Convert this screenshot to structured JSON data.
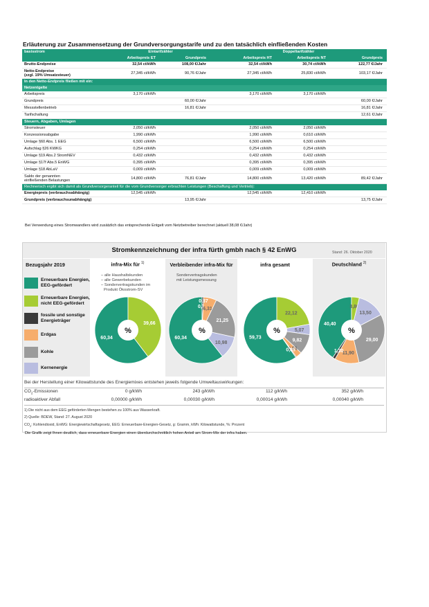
{
  "title": "Erläuterung zur Zusammensetzung der Grundversorgungstarife und zu den tatsächlich einfließenden Kosten",
  "table": {
    "h_product": "basisstrom",
    "h_eintarif": "Eintarifzähler",
    "h_doppel": "Doppeltarifzähler",
    "h_arb_et": "Arbeitspreis ET",
    "h_grund1": "Grundpreis",
    "h_arb_ht": "Arbeitspreis HT",
    "h_arb_nt": "Arbeitspreis NT",
    "h_grund2": "Grundpreis",
    "brutto": {
      "label": "Brutto-Endpreise",
      "et": "32,54 ct/kWh",
      "g1": "108,00 €/Jahr",
      "ht": "32,54 ct/kWh",
      "nt": "30,74 ct/kWh",
      "g2": "122,77 €/Jahr"
    },
    "netto": {
      "label1": "Netto-Endpreise",
      "label2": "(zzgl. 19% Umsatzsteuer)",
      "et": "27,345 ct/kWh",
      "g1": "90,76 €/Jahr",
      "ht": "27,345 ct/kWh",
      "nt": "25,830 ct/kWh",
      "g2": "103,17 €/Jahr"
    },
    "sec1": "In den Netto-Endpreis fließen mit ein:",
    "sub1": "Netzentgelte",
    "netz": [
      {
        "label": "Arbeitspreis",
        "et": "3,170 ct/kWh",
        "g1": "",
        "ht": "3,170 ct/kWh",
        "nt": "3,170 ct/kWh",
        "g2": ""
      },
      {
        "label": "Grundpreis",
        "et": "",
        "g1": "60,00 €/Jahr",
        "ht": "",
        "nt": "",
        "g2": "60,00 €/Jahr"
      },
      {
        "label": "Messstellenbetrieb",
        "et": "",
        "g1": "16,81 €/Jahr",
        "ht": "",
        "nt": "",
        "g2": "16,81 €/Jahr"
      },
      {
        "label": "Tarifschaltung",
        "et": "",
        "g1": "",
        "ht": "",
        "nt": "",
        "g2": "12,61 €/Jahr"
      }
    ],
    "sec2": "Steuern, Abgaben, Umlagen",
    "steuern": [
      {
        "label": "Stromsteuer",
        "et": "2,050 ct/kWh",
        "ht": "2,050 ct/kWh",
        "nt": "2,050 ct/kWh"
      },
      {
        "label": "Konzessionsabgabe",
        "et": "1,990 ct/kWh",
        "ht": "1,990 ct/kWh",
        "nt": "0,610 ct/kWh"
      },
      {
        "label": "Umlage §60 Abs. 1 EEG",
        "et": "6,500 ct/kWh",
        "ht": "6,500 ct/kWh",
        "nt": "6,500 ct/kWh"
      },
      {
        "label": "Aufschlag §26 KWKG",
        "et": "0,254 ct/kWh",
        "ht": "0,254 ct/kWh",
        "nt": "0,254 ct/kWh"
      },
      {
        "label": "Umlage §19 Abs.2 StromNEV",
        "et": "0,432 ct/kWh",
        "ht": "0,432 ct/kWh",
        "nt": "0,432 ct/kWh"
      },
      {
        "label": "Umlage §17f Abs.5 EnWG",
        "et": "0,395 ct/kWh",
        "ht": "0,395 ct/kWh",
        "nt": "0,395 ct/kWh"
      },
      {
        "label": "Umlage §18 AbLaV",
        "et": "0,009 ct/kWh",
        "ht": "0,009 ct/kWh",
        "nt": "0,009 ct/kWh"
      }
    ],
    "saldo": {
      "label1": "Saldo der genannten",
      "label2": "einfließenden Belastungen",
      "et": "14,800 ct/kWh",
      "g1": "76,81 €/Jahr",
      "ht": "14,800 ct/kWh",
      "nt": "13,420 ct/kWh",
      "g2": "89,42 €/Jahr"
    },
    "note": "Rechnerisch ergibt sich damit als Grundversorgeranteil für die vom Grundversorger erbrachten Leistungen (Beschaffung und Vertrieb):",
    "energie": {
      "label": "Energiepreis (verbrauchsabhängig)",
      "et": "12,545 ct/kWh",
      "ht": "12,545 ct/kWh",
      "nt": "12,410 ct/kWh"
    },
    "grund": {
      "label": "Grundpreis (verbrauchsunabhängig)",
      "g1": "13,95 €/Jahr",
      "g2": "13,75 €/Jahr"
    }
  },
  "footnote_table": "Bei Verwendung eines Stromwandlers wird zusätzlich das entsprechende Entgelt vom Netzbetreiber berechnet (aktuell 38,08 €/Jahr)",
  "label": {
    "title": "Stromkennzeichnung der infra fürth gmbh nach § 42 EnWG",
    "stand": "Stand: 26. Oktober 2020",
    "bezugsjahr": "Bezugsjahr 2019",
    "col1": "infra-Mix für",
    "col1_sup": "1)",
    "col2": "Verbleibender infra-Mix für",
    "col3": "infra gesamt",
    "col4": "Deutschland",
    "col4_sup": "2)",
    "col1_list": [
      "– alle Haushaltskunden",
      "– alle Gewerbekunden",
      "– Sondervertragskunden im",
      "  Produkt Ökostrom-SV"
    ],
    "col2_list": [
      "Sondervertragskunden",
      "mit Leistungsmessung"
    ],
    "center": "%",
    "legend": [
      {
        "label": "Erneuerbare Energien, EEG-gefördert",
        "color": "#1e9a7b"
      },
      {
        "label": "Erneuerbare Energien, nicht EEG-gefördert",
        "color": "#a6cc34"
      },
      {
        "label": "fossile und sonstige Energieträger",
        "color": "#3b3b3b"
      },
      {
        "label": "Erdgas",
        "color": "#f6ad6c"
      },
      {
        "label": "Kohle",
        "color": "#9b9b9b"
      },
      {
        "label": "Kernenergie",
        "color": "#b9bde0"
      }
    ]
  },
  "chart_data": [
    {
      "type": "pie",
      "name": "infra-Mix für",
      "labels": [
        "Erneuerbare Energien, EEG-gefördert",
        "Erneuerbare Energien, nicht EEG-gefördert"
      ],
      "values": [
        60.34,
        39.66
      ],
      "value_labels": [
        "60,34",
        "39,66"
      ]
    },
    {
      "type": "pie",
      "name": "Verbleibender infra-Mix für",
      "labels": [
        "Erneuerbare Energien, EEG-gefördert",
        "fossile und sonstige Energieträger",
        "Erdgas",
        "Kohle",
        "Kernenergie"
      ],
      "values": [
        60.34,
        0.75,
        6.31,
        21.25,
        10.98
      ],
      "value_labels": [
        "60,34",
        "0,75",
        "6,31",
        "21,25",
        "10,98"
      ],
      "extra_label": "0,37"
    },
    {
      "type": "pie",
      "name": "infra gesamt",
      "labels": [
        "Erneuerbare Energien, EEG-gefördert",
        "Erneuerbare Energien, nicht EEG-gefördert",
        "Kernenergie",
        "Kohle",
        "Erdgas",
        "fossile und sonstige Energieträger"
      ],
      "values": [
        59.73,
        22.12,
        5.07,
        9.82,
        2.91,
        0.35
      ],
      "value_labels": [
        "59,73",
        "22,12",
        "5,07",
        "9,82",
        "2,91",
        "0,35"
      ]
    },
    {
      "type": "pie",
      "name": "Deutschland",
      "labels": [
        "Erneuerbare Energien, EEG-gefördert",
        "Erneuerbare Energien, nicht EEG-gefördert",
        "Kernenergie",
        "Kohle",
        "Erdgas",
        "fossile und sonstige Energieträger"
      ],
      "values": [
        40.4,
        3.8,
        13.5,
        29.0,
        11.9,
        1.3
      ],
      "value_labels": [
        "40,40",
        "3,80",
        "13,50",
        "29,00",
        "11,90",
        "1,30"
      ]
    }
  ],
  "env": {
    "head": "Bei der Herstellung einer Kilowattstunde des Energiemixes entstehen jeweils folgende Umweltauswirkungen:",
    "co2_label_a": "CO",
    "co2_label_sub": "2",
    "co2_label_b": "-Emissionen",
    "co2": [
      "0 g/kWh",
      "243 g/kWh",
      "112 g/kWh",
      "352 g/kWh"
    ],
    "rad_label": "radioaktiver Abfall",
    "rad": [
      "0,00000 g/kWh",
      "0,00030 g/kWh",
      "0,00014 g/kWh",
      "0,00040 g/kWh"
    ]
  },
  "footnotes": {
    "f1": "1) Die nicht aus dem EEG geförderten Mengen bestehen zu 100% aus Wasserkraft.",
    "f2": "2) Quelle: BDEW, Stand: 27. August 2020",
    "f3a": "CO",
    "f3sub": "2",
    "f3b": ": Kohlendioxid, EnWG: Energiewirtschaftsgesetz, EEG: Erneuerbare-Energien-Gesetz, g: Gramm, kWh: Kilowattstunde, %: Prozent"
  },
  "bottom_note": "Die Grafik zeigt Ihnen deutlich, dass erneuerbare Energien einen überdurchschnittlich hohen Anteil am Strom-Mix der infra haben."
}
